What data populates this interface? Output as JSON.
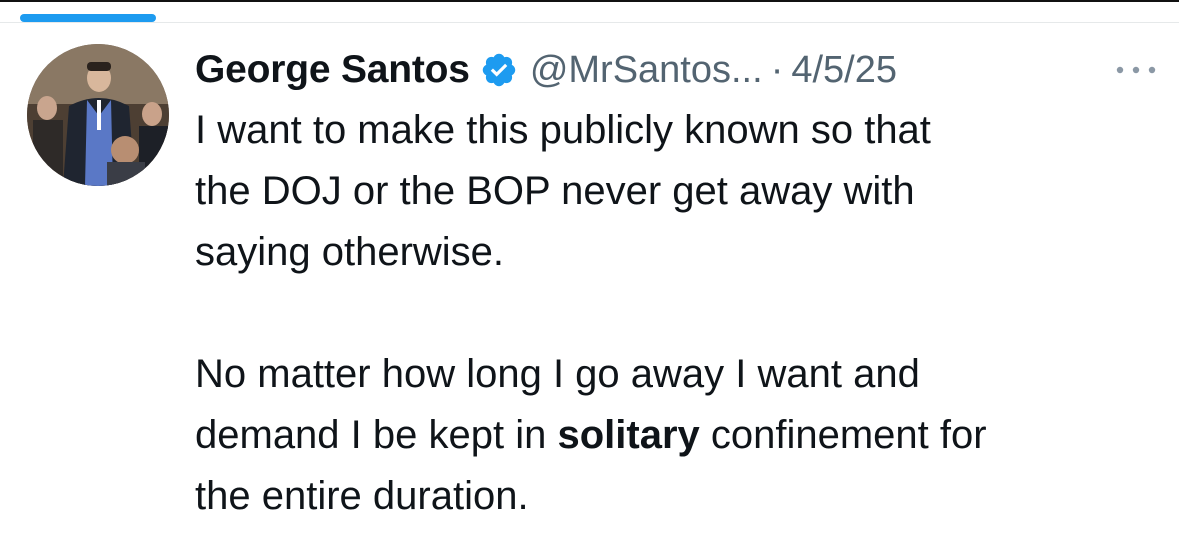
{
  "tweet": {
    "author": {
      "display_name": "George Santos",
      "handle": "@MrSantos...",
      "verified": true
    },
    "separator": "·",
    "date": "4/5/25",
    "more_icon": "more-horizontal-icon",
    "paragraph1": {
      "line1": "I want to make this publicly known so that",
      "line2": "the DOJ or the BOP never get away with",
      "line3": "saying otherwise."
    },
    "paragraph2": {
      "line1": "No matter how long I go away I want and",
      "line2_before": "demand I be kept in ",
      "line2_bold": "solitary",
      "line2_after": " confinement for",
      "line3": "the entire duration."
    }
  },
  "colors": {
    "accent": "#1d9bf0",
    "text_primary": "#0f1419",
    "text_secondary": "#536471"
  }
}
